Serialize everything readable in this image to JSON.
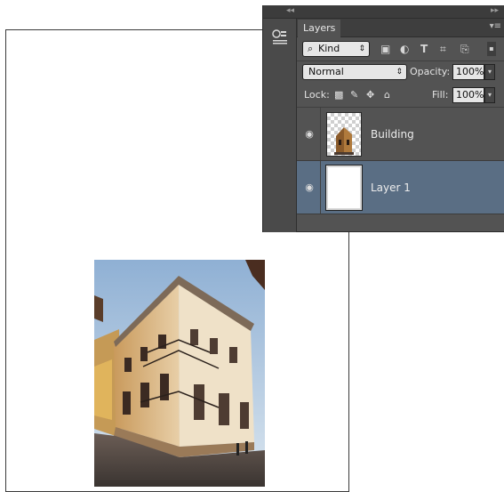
{
  "layers_panel": {
    "tab_label": "Layers",
    "filter": {
      "label": "Kind",
      "selected": "Kind"
    },
    "blend_mode": "Normal",
    "opacity_label": "Opacity:",
    "opacity_value": "100%",
    "lock_label": "Lock:",
    "fill_label": "Fill:",
    "fill_value": "100%",
    "layers": [
      {
        "name": "Building",
        "visible": true,
        "selected": false,
        "thumb": "transparent-building"
      },
      {
        "name": "Layer 1",
        "visible": true,
        "selected": true,
        "thumb": "white-fill"
      }
    ]
  },
  "canvas": {
    "background": "#ffffff",
    "image": "building-photo"
  },
  "colors": {
    "panel_bg": "#535353",
    "selected_layer": "#5a6e84",
    "tab_strip": "#3e3e3e"
  }
}
